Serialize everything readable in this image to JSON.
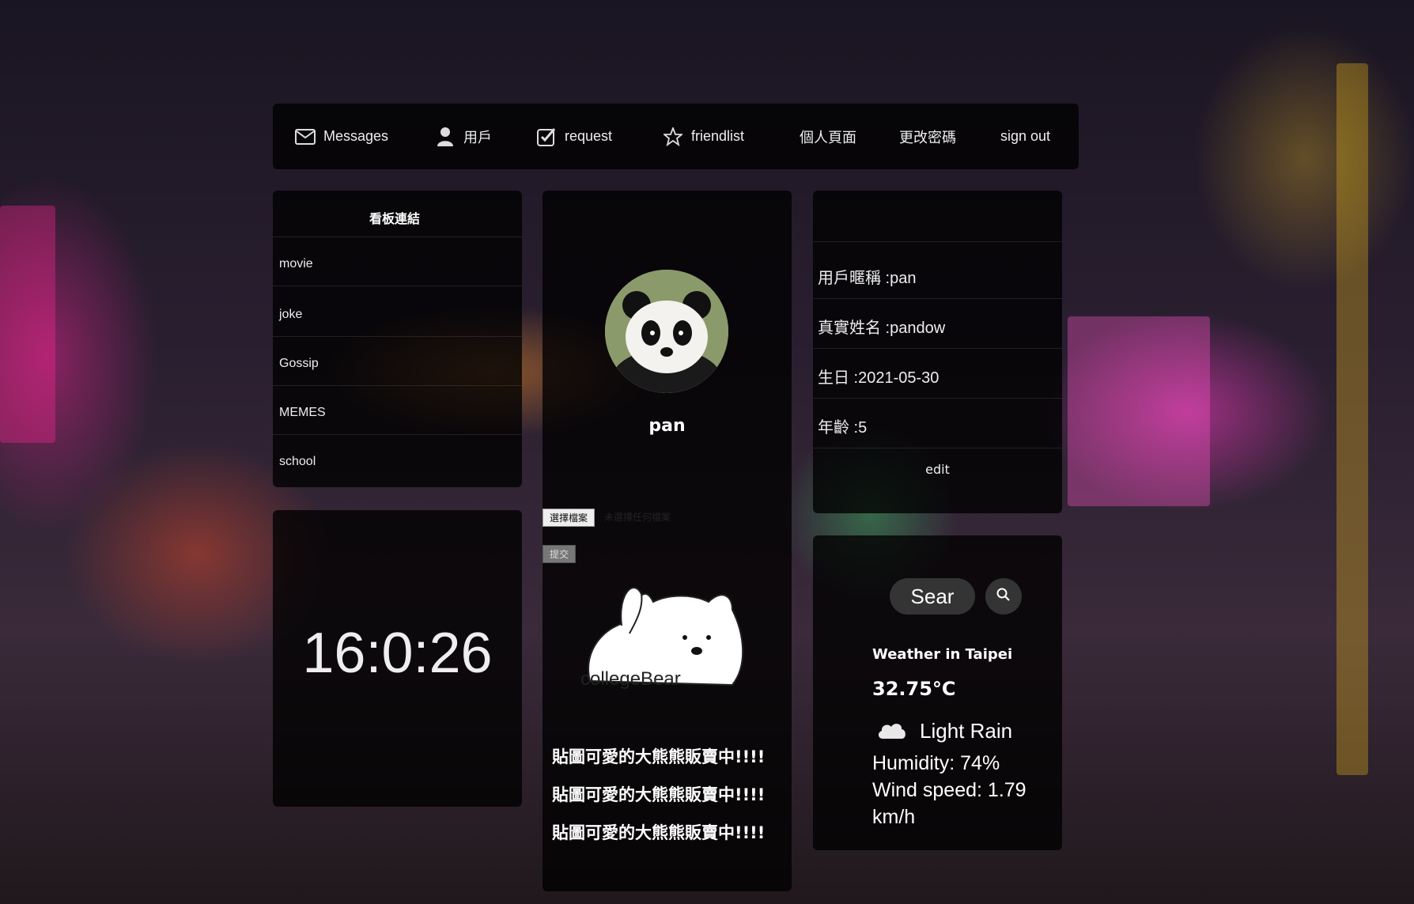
{
  "nav": {
    "messages": "Messages",
    "user": "用戶",
    "request": "request",
    "friendlist": "friendlist",
    "profile": "個人頁面",
    "change_password": "更改密碼",
    "sign_out": "sign out"
  },
  "board": {
    "title": "看板連結",
    "links": [
      "movie",
      "joke",
      "Gossip",
      "MEMES",
      "school"
    ]
  },
  "clock": {
    "time": "16:0:26"
  },
  "profile": {
    "username": "pan",
    "file_button": "選擇檔案",
    "file_status": "未選擇任何檔案",
    "submit": "提交",
    "sticker_text": "collegeBear",
    "promos": [
      "貼圖可愛的大熊熊販賣中!!!!",
      "貼圖可愛的大熊熊販賣中!!!!",
      "貼圖可愛的大熊熊販賣中!!!!"
    ]
  },
  "info": {
    "nickname": "用戶暱稱 :pan",
    "realname": "真實姓名 :pandow",
    "birthday": "生日 :2021-05-30",
    "age": "年齡 :5",
    "edit": "edit"
  },
  "weather": {
    "search_value": "Sear",
    "title": "Weather in Taipei",
    "temp": "32.75°C",
    "description": "Light Rain",
    "humidity": "Humidity: 74%",
    "wind": "Wind speed: 1.79",
    "wind_unit": "km/h"
  },
  "icons": {
    "messages": "envelope-icon",
    "user": "user-icon",
    "request": "check-square-icon",
    "friendlist": "star-icon",
    "search": "search-icon",
    "weather": "cloud-icon"
  }
}
